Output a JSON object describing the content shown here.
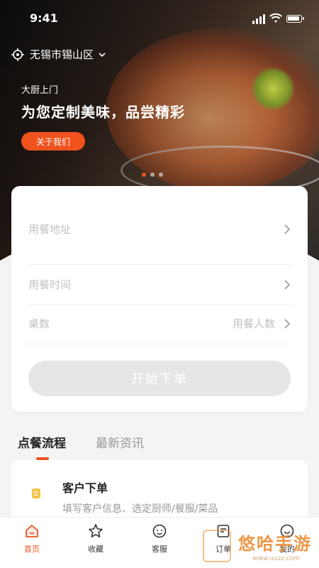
{
  "status_bar": {
    "time": "9:41"
  },
  "location": {
    "city": "无锡市锡山区"
  },
  "banner": {
    "tagline": "大厨上门",
    "headline": "为您定制美味，品尝精彩",
    "about_button": "关于我们",
    "slide_count": 3,
    "active_slide": 1
  },
  "order_form": {
    "address_placeholder": "用餐地址",
    "time_placeholder": "用餐时间",
    "tables_label": "桌数",
    "people_placeholder": "用餐人数",
    "submit_label": "开始下单"
  },
  "tabs": [
    {
      "label": "点餐流程",
      "active": true
    },
    {
      "label": "最新资讯",
      "active": false
    }
  ],
  "process": {
    "steps": [
      {
        "title": "客户下单",
        "description": "填写客户信息、选定厨师/餐服/菜品"
      }
    ]
  },
  "bottom_nav": [
    {
      "label": "首页",
      "icon": "home-icon",
      "active": true
    },
    {
      "label": "收藏",
      "icon": "star-icon",
      "active": false
    },
    {
      "label": "客服",
      "icon": "service-icon",
      "active": false
    },
    {
      "label": "订单",
      "icon": "order-icon",
      "active": false
    },
    {
      "label": "我的",
      "icon": "user-icon",
      "active": false
    }
  ],
  "watermark": {
    "title": "悠哈手游",
    "subtitle": "www.uuzz.com"
  },
  "colors": {
    "accent": "#f0521e",
    "muted_text": "#c2c2c2",
    "background": "#f4f4f4"
  }
}
